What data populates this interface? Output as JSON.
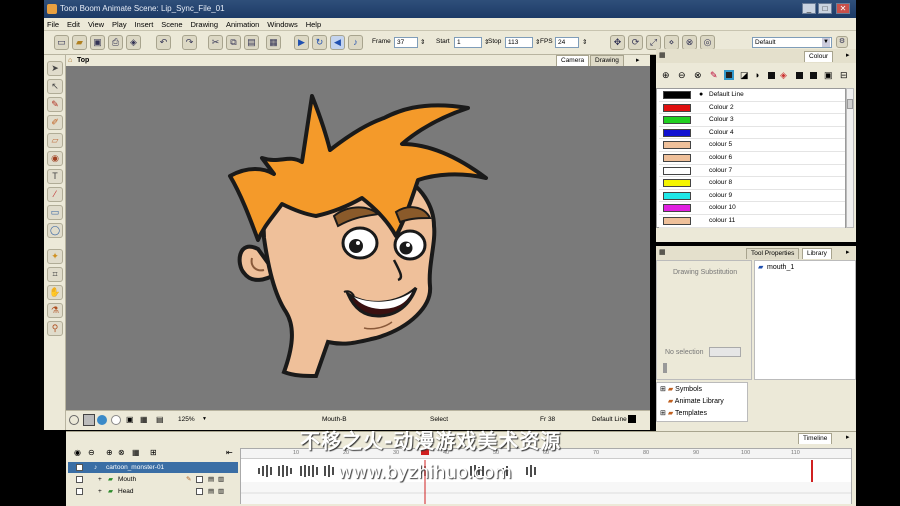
{
  "window": {
    "title": "Toon Boom Animate Scene: Lip_Sync_File_01",
    "controls": [
      "_",
      "□",
      "✕"
    ]
  },
  "menu": [
    "File",
    "Edit",
    "View",
    "Play",
    "Insert",
    "Scene",
    "Drawing",
    "Animation",
    "Windows",
    "Help"
  ],
  "playback": {
    "frame_label": "Frame",
    "frame": "37",
    "start_label": "Start",
    "start": "1",
    "stop_label": "Stop",
    "stop": "113",
    "fps_label": "FPS",
    "fps": "24",
    "workspace": "Default"
  },
  "camera_view": {
    "view_name": "Top",
    "tabs": [
      "Camera",
      "Drawing"
    ],
    "active_tab": "Camera",
    "zoom": "125%",
    "drawing_name": "Mouth-B",
    "tool": "Select",
    "frame_readout": "Fr 38",
    "current_colour": "Default Line"
  },
  "colour_panel": {
    "tab": "Colour",
    "swatches": [
      {
        "name": "Default Line",
        "color": "#000000"
      },
      {
        "name": "Colour 2",
        "color": "#e01010"
      },
      {
        "name": "Colour 3",
        "color": "#20d020"
      },
      {
        "name": "Colour 4",
        "color": "#1010d0"
      },
      {
        "name": "colour 5",
        "color": "#efc09a"
      },
      {
        "name": "colour 6",
        "color": "#efc09a"
      },
      {
        "name": "colour 7",
        "color": "#ffffff"
      },
      {
        "name": "colour 8",
        "color": "#f4f400"
      },
      {
        "name": "colour 9",
        "color": "#20e8e8"
      },
      {
        "name": "colour 10",
        "color": "#e020e0"
      },
      {
        "name": "colour 11",
        "color": "#efc09a"
      }
    ]
  },
  "library_panel": {
    "tabs": [
      "Tool Properties",
      "Library"
    ],
    "active_tab": "Library",
    "substitution_label": "Drawing Substitution",
    "item": "mouth_1",
    "no_selection": "No selection",
    "tree": [
      "Symbols",
      "Animate Library",
      "Templates"
    ]
  },
  "timeline": {
    "tab": "Timeline",
    "layers": [
      {
        "name": "cartoon_monster-01",
        "selected": true
      },
      {
        "name": "Mouth",
        "selected": false
      },
      {
        "name": "Head",
        "selected": false
      }
    ],
    "ruler": [
      "10",
      "20",
      "30",
      "40",
      "50",
      "60",
      "70",
      "80",
      "90",
      "100",
      "110"
    ]
  },
  "watermark": {
    "line1": "不移之火-动漫游戏美术资源",
    "line2": "www.byzhihuo.com"
  }
}
